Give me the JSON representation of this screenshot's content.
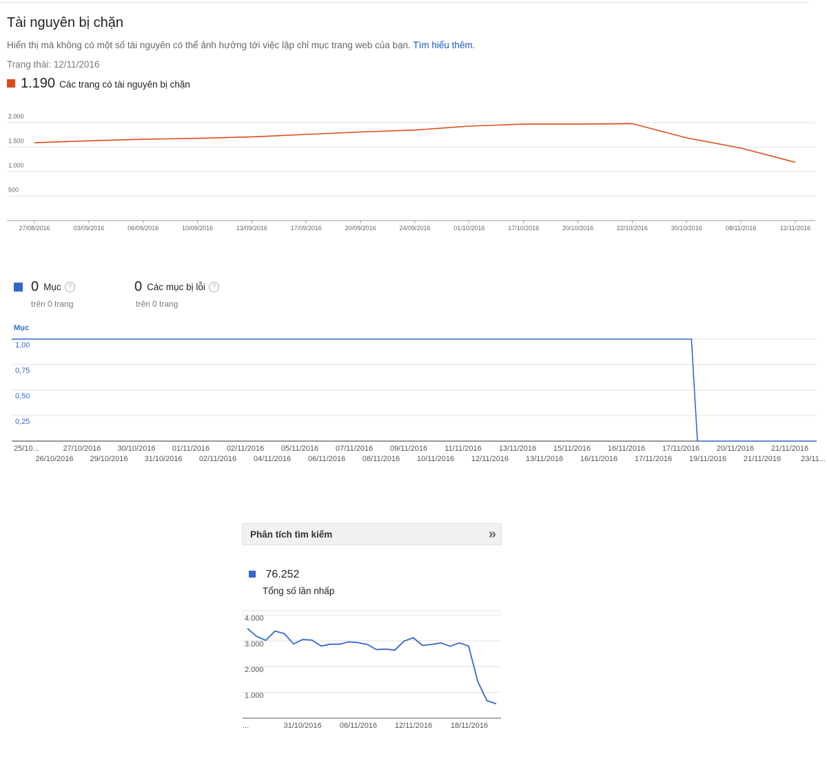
{
  "header": {
    "title": "Tài nguyên bị chặn",
    "description": "Hiển thị mà không có một số tài nguyên có thể ảnh hưởng tới việc lập chỉ mục trang web của bạn.",
    "learn_more": "Tìm hiểu thêm.",
    "status": "Trạng thái: 12/11/2016"
  },
  "legend1": {
    "value": "1.190",
    "label": "Các trang có tài nguyên bị chặn",
    "color": "#dd4b1a"
  },
  "chart_data": [
    {
      "type": "line",
      "series": [
        {
          "values": [
            1590,
            1630,
            1660,
            1680,
            1710,
            1760,
            1810,
            1850,
            1930,
            1970,
            1970,
            1980,
            1690,
            1480,
            1190
          ],
          "color": "#dd4b1a"
        }
      ],
      "categories": [
        "27/08/2016",
        "03/09/2016",
        "06/09/2016",
        "10/09/2016",
        "13/09/2016",
        "17/09/2016",
        "20/09/2016",
        "24/09/2016",
        "01/10/2016",
        "17/10/2016",
        "20/10/2016",
        "22/10/2016",
        "30/10/2016",
        "08/11/2016",
        "12/11/2016"
      ],
      "yticks": [
        "2.000",
        "1.500",
        "1.000",
        "500"
      ],
      "ylim": [
        0,
        2000
      ],
      "grid": true
    },
    {
      "type": "line",
      "title": "Mục",
      "series": [
        {
          "values": [
            1,
            1,
            1,
            1,
            1,
            1,
            1,
            1,
            1,
            1,
            1,
            1,
            1,
            1,
            1,
            1,
            1,
            1,
            1,
            1,
            1,
            1,
            1,
            1,
            1,
            1,
            1,
            1,
            1,
            1,
            1,
            1,
            1,
            1,
            1,
            1,
            1,
            1,
            1,
            1,
            1,
            1,
            1,
            1,
            1,
            1,
            1,
            1,
            1,
            1,
            1,
            1,
            1,
            1,
            1,
            1,
            1,
            1,
            1,
            1,
            1,
            1,
            1,
            1,
            1,
            1,
            1,
            1,
            1,
            1,
            1,
            1,
            1,
            1,
            1,
            1,
            1,
            1,
            1,
            1,
            1,
            1,
            1,
            1,
            1,
            1,
            1,
            1,
            1,
            1,
            1,
            1,
            1,
            1,
            1,
            1,
            1,
            1,
            1,
            1,
            1,
            1,
            1,
            1,
            1,
            1,
            1,
            1,
            1,
            1,
            1,
            1,
            1,
            1,
            1,
            0,
            0,
            0,
            0,
            0,
            0,
            0,
            0,
            0,
            0,
            0,
            0,
            0,
            0,
            0,
            0,
            0,
            0,
            0,
            0,
            0
          ],
          "color": "#3366cc"
        }
      ],
      "xticks_top": [
        "25/10...",
        "27/10/2016",
        "30/10/2016",
        "01/11/2016",
        "02/11/2016",
        "05/11/2016",
        "07/11/2016",
        "09/11/2016",
        "11/11/2016",
        "13/11/2016",
        "15/11/2016",
        "16/11/2016",
        "17/11/2016",
        "20/11/2016",
        "21/11/2016"
      ],
      "xticks_bottom": [
        "26/10/2016",
        "29/10/2016",
        "31/10/2016",
        "02/11/2016",
        "04/11/2016",
        "06/11/2016",
        "08/11/2016",
        "10/11/2016",
        "12/11/2016",
        "13/11/2016",
        "16/11/2016",
        "17/11/2016",
        "19/11/2016",
        "21/11/2016",
        "23/11..."
      ],
      "yticks": [
        "1,00",
        "0,75",
        "0,50",
        "0,25"
      ],
      "ylim": [
        0,
        1.2
      ],
      "grid": true
    },
    {
      "type": "line",
      "series": [
        {
          "values": [
            3480,
            3170,
            3020,
            3380,
            3280,
            2880,
            3050,
            3030,
            2800,
            2870,
            2870,
            2960,
            2930,
            2860,
            2660,
            2680,
            2640,
            2990,
            3120,
            2820,
            2860,
            2920,
            2790,
            2920,
            2800,
            1420,
            680,
            560
          ],
          "color": "#3366cc"
        }
      ],
      "xticks": [
        "...",
        "31/10/2016",
        "06/11/2016",
        "12/11/2016",
        "18/11/2016"
      ],
      "yticks": [
        "4.000",
        "3.000",
        "2.000",
        "1.000"
      ],
      "ylim": [
        0,
        4400
      ],
      "grid": true
    }
  ],
  "stats": [
    {
      "value": "0",
      "label": "Mục",
      "sub": "trên 0 trang",
      "color": "#3366cc"
    },
    {
      "value": "0",
      "label": "Các mục bị lỗi",
      "sub": "trên 0 trang"
    }
  ],
  "help_glyph": "?",
  "search_panel": {
    "title": "Phân tích tìm kiếm",
    "chevron": "»",
    "legend_value": "76.252",
    "legend_label": "Tổng số lần nhấp",
    "legend_color": "#3366cc"
  }
}
